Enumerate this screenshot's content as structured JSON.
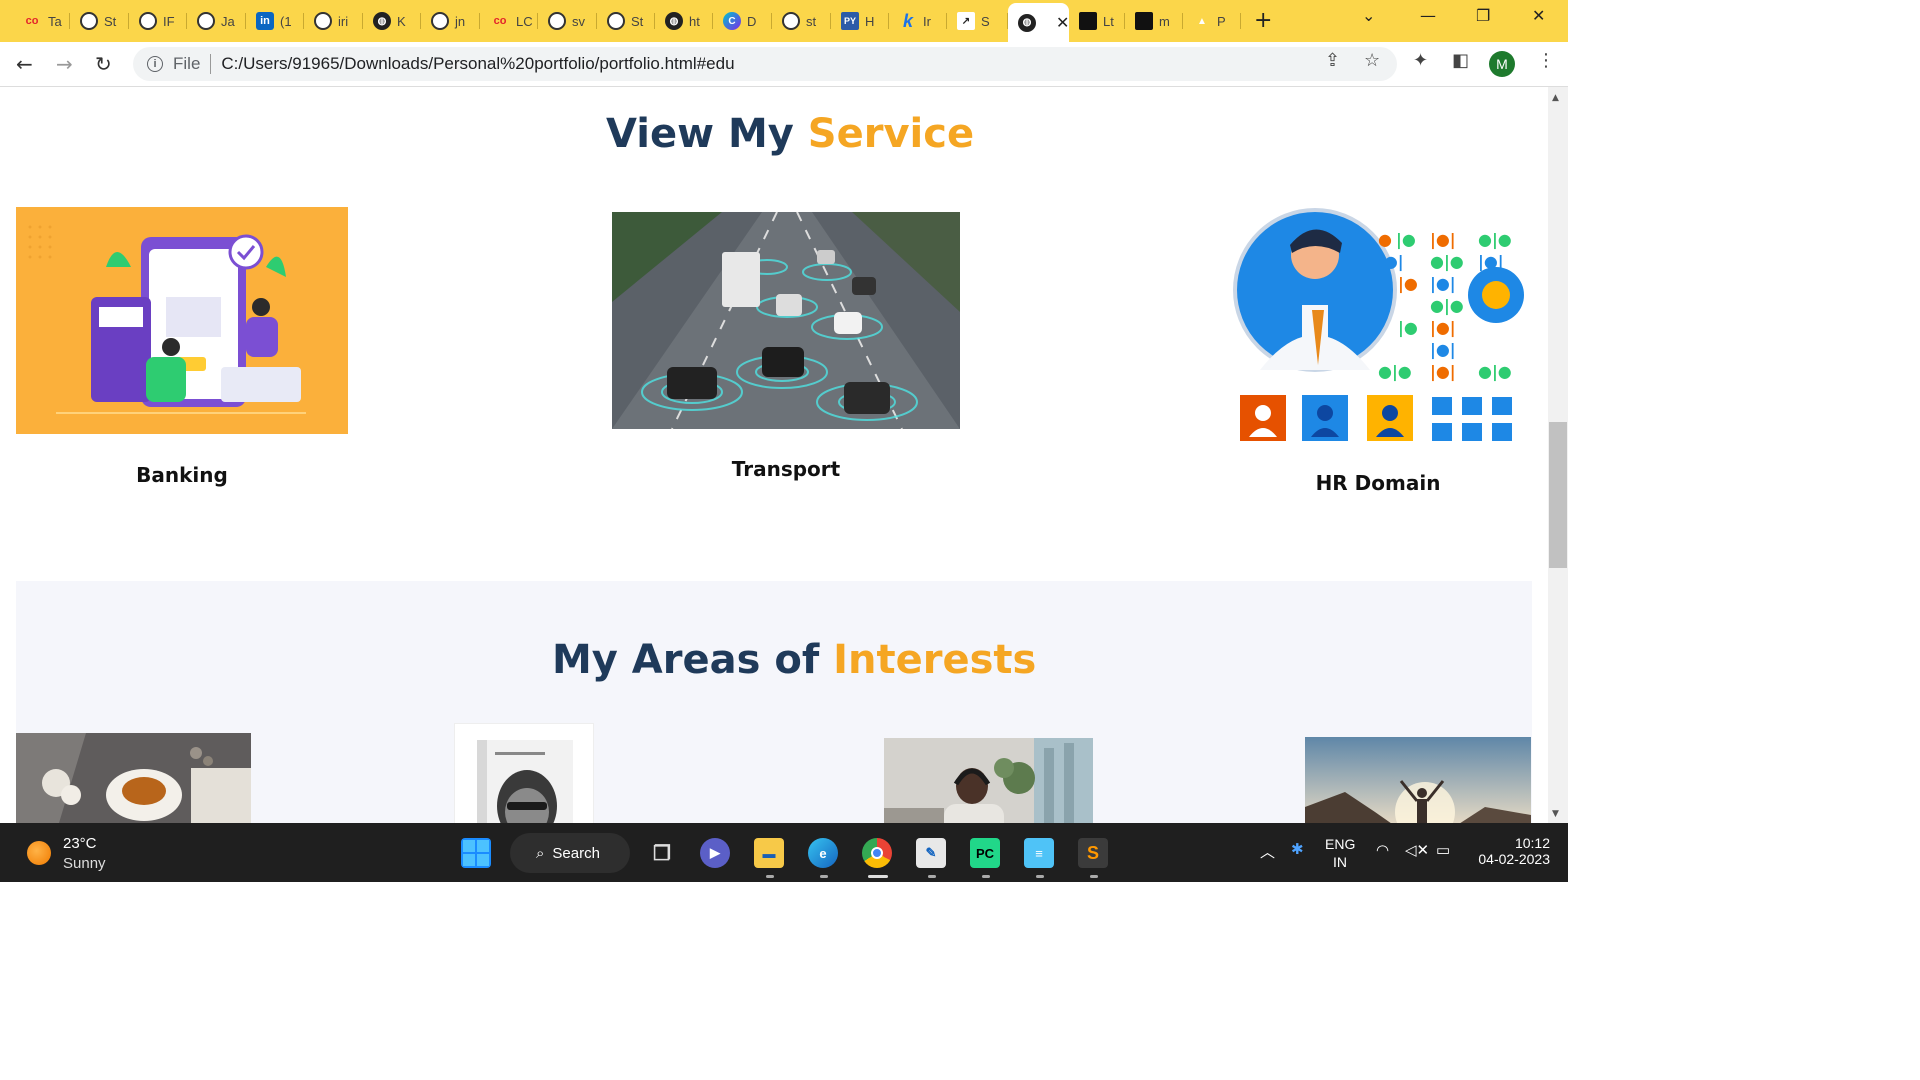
{
  "browser": {
    "tabs": [
      {
        "icon": "coursera-icon",
        "label": "Ta"
      },
      {
        "icon": "github-icon",
        "label": "St"
      },
      {
        "icon": "github-icon",
        "label": "IF"
      },
      {
        "icon": "github-icon",
        "label": "Ja"
      },
      {
        "icon": "linkedin-icon",
        "label": "(1"
      },
      {
        "icon": "github-icon",
        "label": "iri"
      },
      {
        "icon": "globe-icon",
        "label": "K"
      },
      {
        "icon": "github-icon",
        "label": "jn"
      },
      {
        "icon": "coursera-icon",
        "label": "LC"
      },
      {
        "icon": "github-icon",
        "label": "sv"
      },
      {
        "icon": "github-icon",
        "label": "St"
      },
      {
        "icon": "globe-icon",
        "label": "ht"
      },
      {
        "icon": "canva-icon",
        "label": "D"
      },
      {
        "icon": "github-icon",
        "label": "st"
      },
      {
        "icon": "python-icon",
        "label": "H"
      },
      {
        "icon": "kaggle-icon",
        "label": "Ir"
      },
      {
        "icon": "chart-icon",
        "label": "S"
      },
      {
        "icon": "globe-icon",
        "label": ""
      },
      {
        "icon": "dark-app-icon",
        "label": "Lt"
      },
      {
        "icon": "dark-app-icon",
        "label": "m"
      },
      {
        "icon": "google-drive-icon",
        "label": "P"
      }
    ],
    "active_tab_index": 17,
    "new_tab_label": "+",
    "address": {
      "scheme": "File",
      "url": "C:/Users/91965/Downloads/Personal%20portfolio/portfolio.html#edu"
    },
    "profile_initial": "M",
    "accent_color": "#fbd64a"
  },
  "page": {
    "service_heading": {
      "part1": "View My ",
      "part2": "Service"
    },
    "services": [
      {
        "label": "Banking",
        "image": "banking-illustration"
      },
      {
        "label": "Transport",
        "image": "autonomous-traffic-photo"
      },
      {
        "label": "HR Domain",
        "image": "hr-domain-illustration"
      }
    ],
    "interests_heading": {
      "part1": "My Areas of ",
      "part2": "Interests"
    },
    "interests": [
      {
        "image": "tea-cup-photo"
      },
      {
        "image": "book-cover-photo"
      },
      {
        "image": "woman-with-headphones-photo"
      },
      {
        "image": "mountain-person-photo"
      }
    ],
    "colors": {
      "heading": "#1f3a5a",
      "accent": "#f5a623"
    }
  },
  "taskbar": {
    "weather": {
      "temp": "23°C",
      "condition": "Sunny"
    },
    "search_label": "Search",
    "language": {
      "line1": "ENG",
      "line2": "IN"
    },
    "time": "10:12",
    "date": "04-02-2023"
  }
}
